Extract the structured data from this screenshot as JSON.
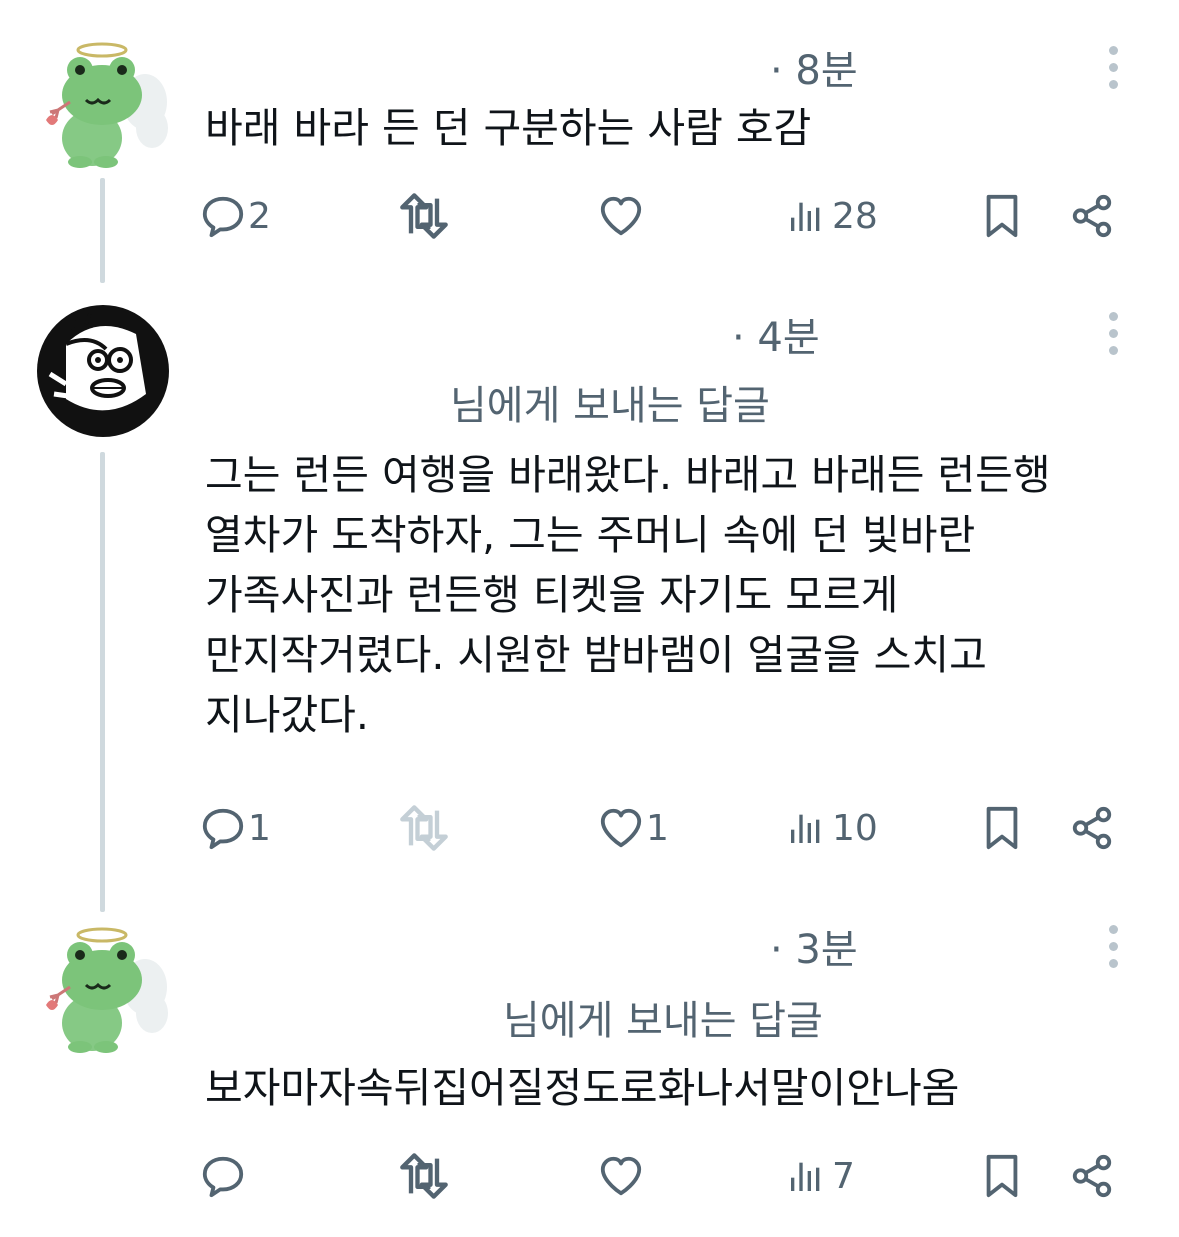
{
  "posts": [
    {
      "time": "· 8분",
      "reply_to": "",
      "text": "바래 바라 든 던 구분하는 사람 호감",
      "avatar": "frog-angel-avatar",
      "actions": {
        "reply": "2",
        "repost": "",
        "like": "",
        "views": "28",
        "repost_disabled": false
      }
    },
    {
      "time": "· 4분",
      "reply_to": "님에게 보내는 답글",
      "text": "그는 런든 여행을 바래왔다. 바래고 바래든 런든행\n열차가 도착하자, 그는 주머니 속에 던 빛바란\n가족사진과 런든행 티켓을 자기도 모르게\n만지작거렸다. 시원한 밤바램이 얼굴을 스치고\n지나갔다.",
      "avatar": "cartoon-boy-avatar",
      "actions": {
        "reply": "1",
        "repost": "",
        "like": "1",
        "views": "10",
        "repost_disabled": true
      }
    },
    {
      "time": "· 3분",
      "reply_to": "님에게 보내는 답글",
      "text": "보자마자속뒤집어질정도로화나서말이안나옴",
      "avatar": "frog-angel-avatar",
      "actions": {
        "reply": "",
        "repost": "",
        "like": "",
        "views": "7",
        "repost_disabled": false
      }
    }
  ],
  "icons": {
    "reply": "reply-icon",
    "repost": "repost-icon",
    "like": "heart-icon",
    "views": "views-icon",
    "bookmark": "bookmark-icon",
    "share": "share-icon",
    "more": "more-icon"
  },
  "colors": {
    "text": "#0f1419",
    "secondary": "#536471",
    "thread_line": "#cfd9de",
    "frog": "#7cc47a"
  }
}
